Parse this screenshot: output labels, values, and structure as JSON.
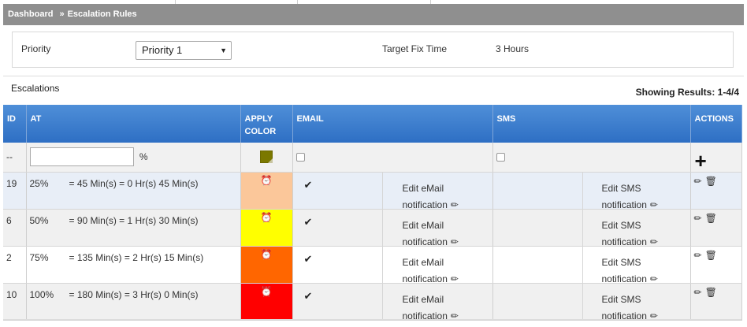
{
  "breadcrumb": {
    "home": "Dashboard",
    "separator": "»",
    "current": "Escalation Rules"
  },
  "priority_panel": {
    "priority_label": "Priority",
    "priority_value": "Priority 1",
    "target_label": "Target Fix Time",
    "target_value": "3 Hours"
  },
  "escalations": {
    "title": "Escalations",
    "results": "Showing Results: 1-4/4",
    "columns": {
      "id": "ID",
      "at": "AT",
      "apply_color": "APPLY COLOR",
      "email": "EMAIL",
      "sms": "SMS",
      "actions": "ACTIONS"
    },
    "add_row": {
      "id": "--",
      "percent_sign": "%",
      "default_color": "#7b7800"
    },
    "rows": [
      {
        "id": "19",
        "pct": "25%",
        "detail": "= 45 Min(s) = 0 Hr(s) 45 Min(s)",
        "color": "#fbc79a",
        "email_edit": "Edit eMail notification",
        "sms_edit": "Edit SMS notification"
      },
      {
        "id": "6",
        "pct": "50%",
        "detail": "= 90 Min(s) = 1 Hr(s) 30 Min(s)",
        "color": "#ffff00",
        "email_edit": "Edit eMail notification",
        "sms_edit": "Edit SMS notification"
      },
      {
        "id": "2",
        "pct": "75%",
        "detail": "= 135 Min(s) = 2 Hr(s) 15 Min(s)",
        "color": "#ff6600",
        "email_edit": "Edit eMail notification",
        "sms_edit": "Edit SMS notification"
      },
      {
        "id": "10",
        "pct": "100%",
        "detail": "= 180 Min(s) = 3 Hr(s) 0 Min(s)",
        "color": "#ff0000",
        "email_edit": "Edit eMail notification",
        "sms_edit": "Edit SMS notification"
      }
    ]
  },
  "icons": {
    "alarm": "alarm-clock-icon",
    "check": "check-icon",
    "pencil": "pencil-icon",
    "trash": "trash-icon",
    "plus": "plus-icon",
    "caret": "caret-down-icon"
  }
}
